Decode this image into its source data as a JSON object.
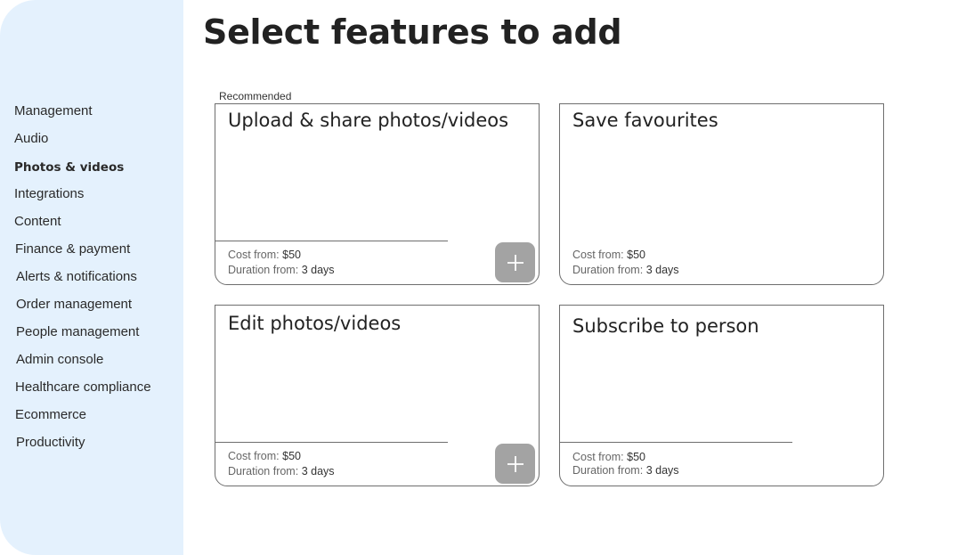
{
  "header": {
    "title": "Select features to add"
  },
  "sidebar": {
    "items": [
      {
        "label": "Management"
      },
      {
        "label": "Audio"
      },
      {
        "label": "Photos & videos"
      },
      {
        "label": "Integrations"
      },
      {
        "label": "Content"
      },
      {
        "label": "Finance & payment"
      },
      {
        "label": "Alerts & notifications"
      },
      {
        "label": "Order management"
      },
      {
        "label": "People management"
      },
      {
        "label": "Admin console"
      },
      {
        "label": "Healthcare compliance"
      },
      {
        "label": "Ecommerce"
      },
      {
        "label": "Productivity"
      }
    ],
    "active": "Photos & videos"
  },
  "main": {
    "section_label": "Recommended",
    "cards": [
      {
        "title": "Upload & share photos/videos",
        "cost_label": "Cost from:",
        "cost": "$50",
        "duration_label": "Duration from:",
        "duration": "3 days",
        "add_icon": "plus-icon"
      },
      {
        "title": "Save favourites",
        "cost_label": "Cost from:",
        "cost": "$50",
        "duration_label": "Duration from:",
        "duration": "3 days"
      },
      {
        "title": "Edit photos/videos",
        "cost_label": "Cost from:",
        "cost": "$50",
        "duration_label": "Duration from:",
        "duration": "3 days",
        "add_icon": "plus-icon"
      },
      {
        "title": "Subscribe to person",
        "cost_label": "Cost from:",
        "cost": "$50",
        "duration_label": "Duration from:",
        "duration": "3 days"
      }
    ]
  },
  "colors": {
    "sidebar_bg": "#e4f1fd",
    "card_border": "#6e6e6e",
    "add_button": "#a3a3a3"
  }
}
